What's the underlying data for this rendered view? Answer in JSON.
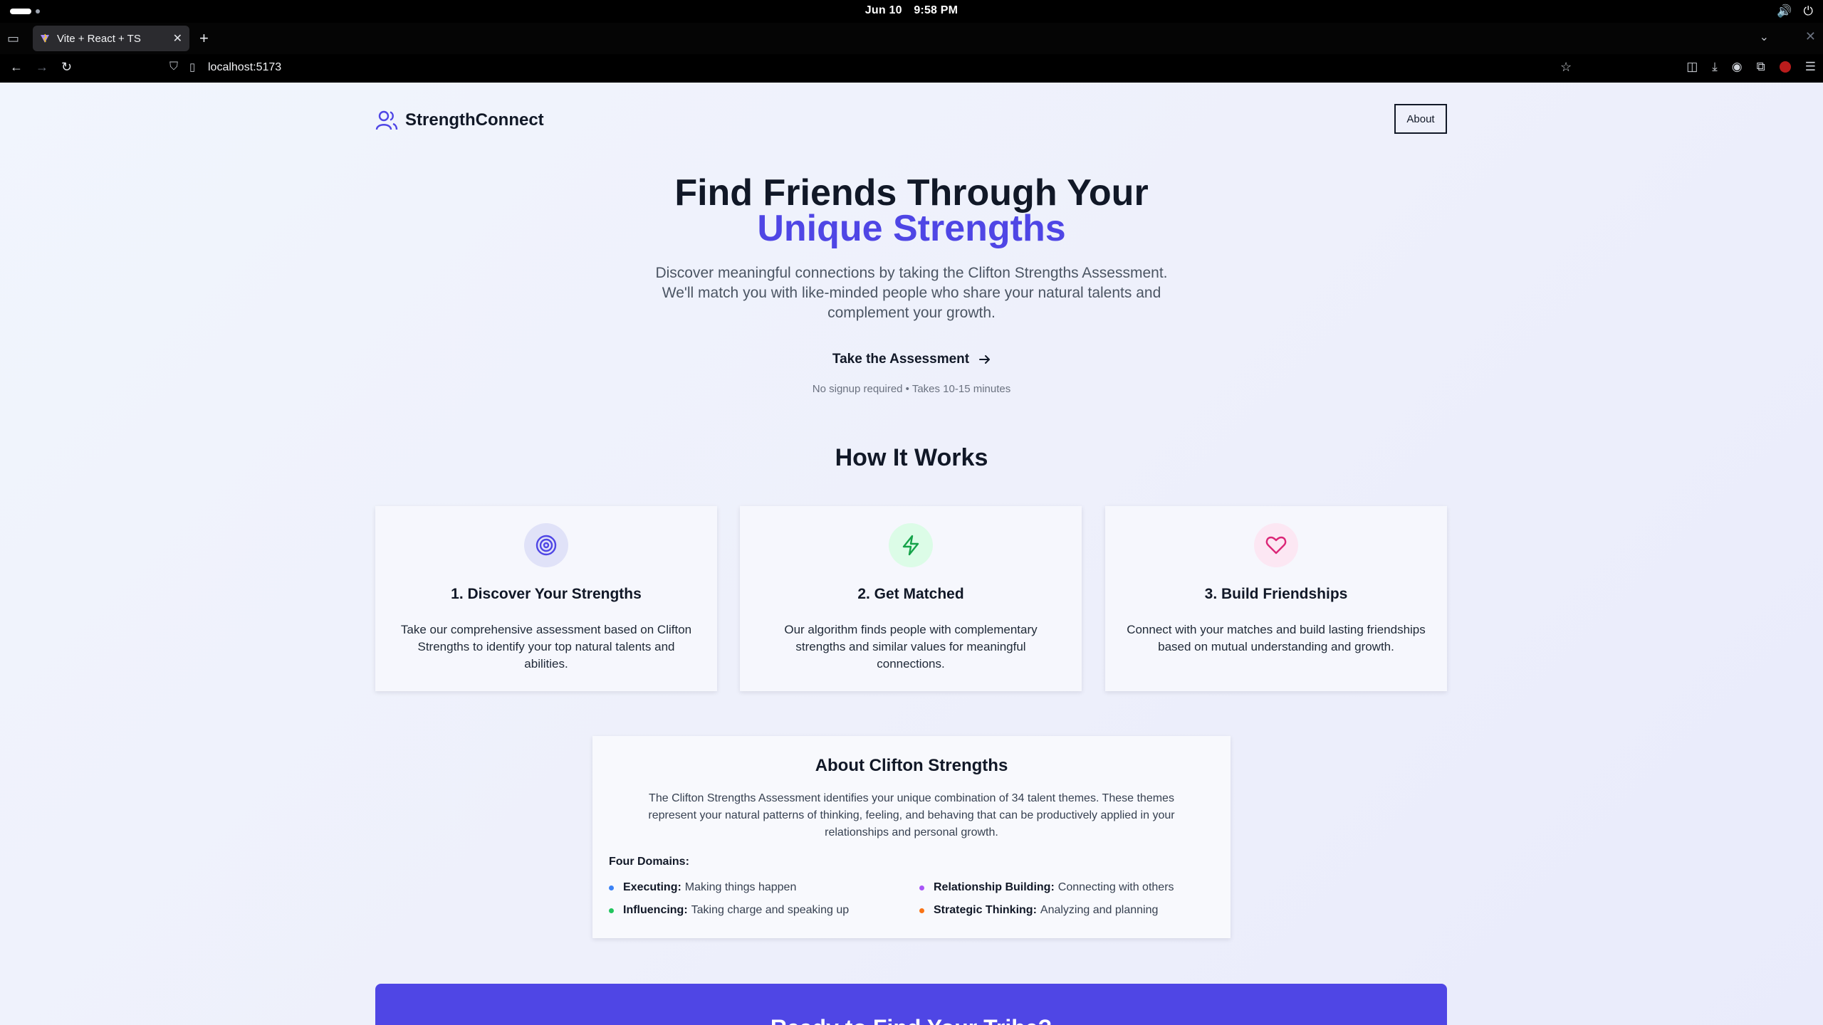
{
  "os": {
    "date": "Jun 10",
    "time": "9:58 PM"
  },
  "browser": {
    "tab_title": "Vite + React + TS",
    "url": "localhost:5173"
  },
  "header": {
    "brand": "StrengthConnect",
    "about_label": "About"
  },
  "hero": {
    "title_line1": "Find Friends Through Your",
    "title_line2": "Unique Strengths",
    "subtitle": "Discover meaningful connections by taking the Clifton Strengths Assessment. We'll match you with like-minded people who share your natural talents and complement your growth.",
    "cta_label": "Take the Assessment",
    "cta_note": "No signup required • Takes 10-15 minutes"
  },
  "how_it_works": {
    "title": "How It Works",
    "steps": [
      {
        "title": "1. Discover Your Strengths",
        "text": "Take our comprehensive assessment based on Clifton Strengths to identify your top natural talents and abilities.",
        "icon": "target-icon",
        "color": "#4f46e5",
        "bg": "#e0e2f8"
      },
      {
        "title": "2. Get Matched",
        "text": "Our algorithm finds people with complementary strengths and similar values for meaningful connections.",
        "icon": "lightning-icon",
        "color": "#16a34a",
        "bg": "#dcfce7"
      },
      {
        "title": "3. Build Friendships",
        "text": "Connect with your matches and build lasting friendships based on mutual understanding and growth.",
        "icon": "heart-icon",
        "color": "#db2777",
        "bg": "#fce7f3"
      }
    ]
  },
  "about": {
    "title": "About Clifton Strengths",
    "text": "The Clifton Strengths Assessment identifies your unique combination of 34 talent themes. These themes represent your natural patterns of thinking, feeling, and behaving that can be productively applied in your relationships and personal growth.",
    "domains_label": "Four Domains:",
    "domains": [
      {
        "name": "Executing:",
        "desc": "Making things happen",
        "color": "#3b82f6"
      },
      {
        "name": "Relationship Building:",
        "desc": "Connecting with others",
        "color": "#a855f7"
      },
      {
        "name": "Influencing:",
        "desc": "Taking charge and speaking up",
        "color": "#22c55e"
      },
      {
        "name": "Strategic Thinking:",
        "desc": "Analyzing and planning",
        "color": "#f97316"
      }
    ]
  },
  "cta_banner": {
    "title": "Ready to Find Your Tribe?"
  }
}
